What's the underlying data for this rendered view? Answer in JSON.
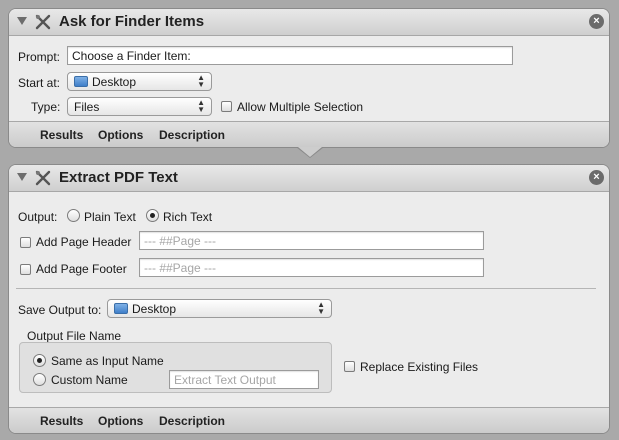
{
  "action1": {
    "title": "Ask for Finder Items",
    "prompt_label": "Prompt:",
    "prompt_value": "Choose a Finder Item:",
    "start_at_label": "Start at:",
    "start_at_value": "Desktop",
    "type_label": "Type:",
    "type_value": "Files",
    "allow_multiple_label": "Allow Multiple Selection",
    "tabs": [
      "Results",
      "Options",
      "Description"
    ]
  },
  "action2": {
    "title": "Extract PDF Text",
    "output_label": "Output:",
    "plain_text_label": "Plain Text",
    "rich_text_label": "Rich Text",
    "add_header_label": "Add Page Header",
    "header_placeholder": "--- ##Page ---",
    "add_footer_label": "Add Page Footer",
    "footer_placeholder": "--- ##Page ---",
    "save_output_label": "Save Output to:",
    "save_output_value": "Desktop",
    "output_file_name_label": "Output File Name",
    "same_as_input_label": "Same as Input Name",
    "custom_name_label": "Custom Name",
    "custom_name_placeholder": "Extract Text Output",
    "replace_existing_label": "Replace Existing Files",
    "tabs": [
      "Results",
      "Options",
      "Description"
    ]
  },
  "icons": {
    "close": "×",
    "popup_arrows": "▲▼"
  }
}
